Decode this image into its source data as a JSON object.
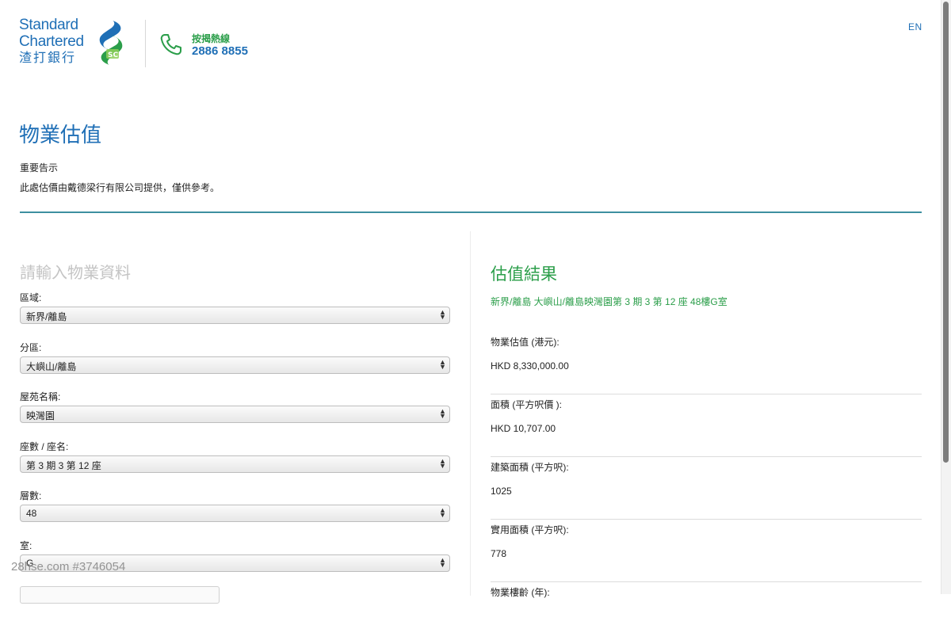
{
  "header": {
    "logo_line1": "Standard",
    "logo_line2": "Chartered",
    "logo_line3": "渣打銀行",
    "hotline_label": "按揭熱線",
    "hotline_number": "2886 8855",
    "language_toggle": "EN"
  },
  "page": {
    "title": "物業估值",
    "notice_title": "重要告示",
    "notice_text": "此處估價由戴德梁行有限公司提供，僅供參考。"
  },
  "form": {
    "heading": "請輸入物業資料",
    "fields": [
      {
        "label": "區域:",
        "value": "新界/離島"
      },
      {
        "label": "分區:",
        "value": "大嶼山/離島"
      },
      {
        "label": "屋苑名稱:",
        "value": "映灣園"
      },
      {
        "label": "座數 / 座名:",
        "value": "第 3 期 3 第 12 座"
      },
      {
        "label": "層數:",
        "value": "48"
      },
      {
        "label": "室:",
        "value": "G"
      }
    ]
  },
  "result": {
    "heading": "估值結果",
    "address": "新界/離島 大嶼山/離島映灣園第 3 期 3 第 12 座 48樓G室",
    "items": [
      {
        "label": "物業估值 (港元):",
        "value": "HKD 8,330,000.00"
      },
      {
        "label": "面積 (平方呎價 ):",
        "value": "HKD 10,707.00"
      },
      {
        "label": "建築面積 (平方呎):",
        "value": "1025"
      },
      {
        "label": "實用面積 (平方呎):",
        "value": "778"
      },
      {
        "label": "物業樓齡 (年):",
        "value": ""
      }
    ]
  },
  "watermark": "28hse.com #3746054",
  "colors": {
    "brand_blue": "#1f6fb6",
    "brand_green": "#2b9e4a",
    "divider_teal": "#3d8fa0"
  }
}
